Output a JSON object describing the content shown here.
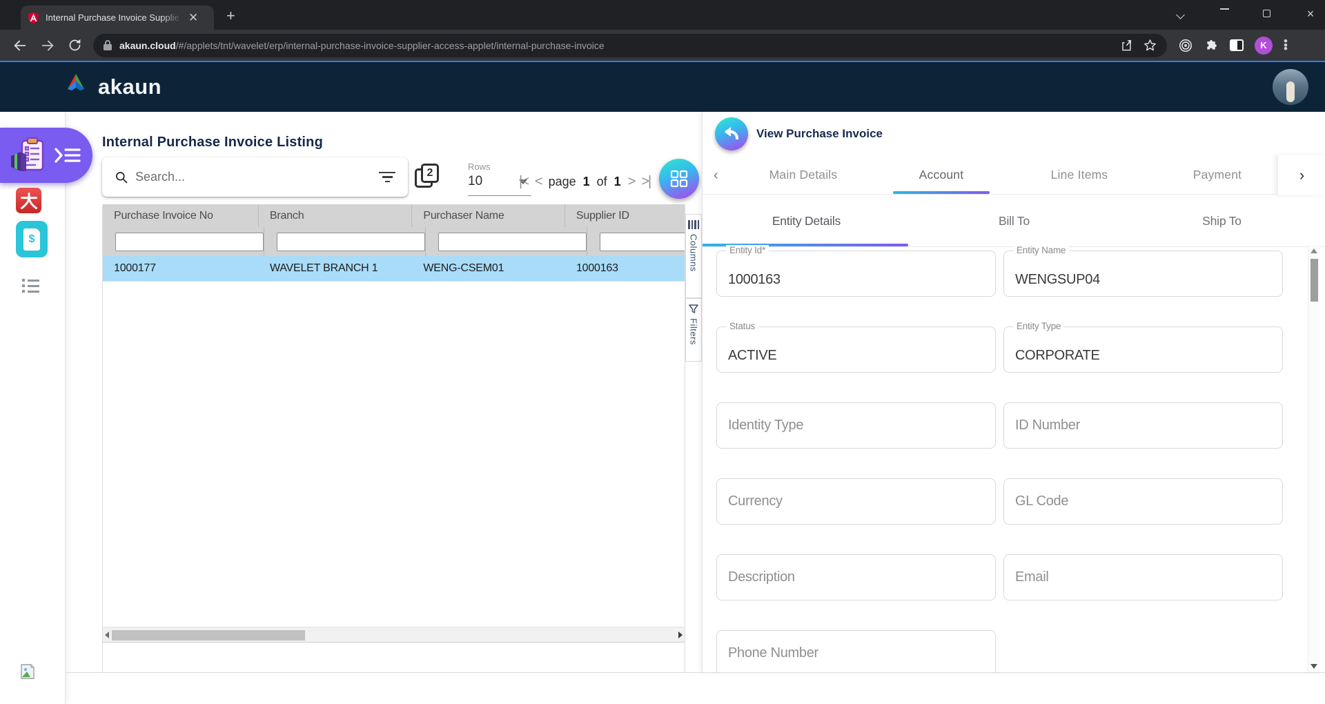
{
  "browser": {
    "tab_title": "Internal Purchase Invoice Supplie",
    "url_host": "akaun.cloud",
    "url_path": "/#/applets/tnt/wavelet/erp/internal-purchase-invoice-supplier-access-applet/internal-purchase-invoice",
    "profile_initial": "K"
  },
  "header": {
    "brand": "akaun"
  },
  "sidebar": {
    "da_glyph": "大",
    "doc_glyph": "$"
  },
  "listing": {
    "title": "Internal Purchase Invoice Listing",
    "search_placeholder": "Search...",
    "rows_label": "Rows",
    "rows_value": "10",
    "pagination": {
      "page_word": "page",
      "page_num": "1",
      "of_word": "of",
      "page_total": "1"
    },
    "table": {
      "columns": [
        "Purchase Invoice No",
        "Branch",
        "Purchaser Name",
        "Supplier ID"
      ],
      "rows": [
        [
          "1000177",
          "WAVELET BRANCH 1",
          "WENG-CSEM01",
          "1000163"
        ]
      ]
    },
    "side_strip": {
      "columns_label": "Columns",
      "filters_label": "Filters"
    }
  },
  "detail": {
    "title": "View Purchase Invoice",
    "tabs": [
      {
        "label": "Main Details"
      },
      {
        "label": "Account"
      },
      {
        "label": "Line Items"
      },
      {
        "label": "Payment"
      }
    ],
    "active_tab": "Account",
    "subtabs": [
      {
        "label": "Entity Details"
      },
      {
        "label": "Bill To"
      },
      {
        "label": "Ship To"
      }
    ],
    "active_subtab": "Entity Details",
    "fields": [
      {
        "label": "Entity Id*",
        "value": "1000163"
      },
      {
        "label": "Entity Name",
        "value": "WENGSUP04"
      },
      {
        "label": "Status",
        "value": "ACTIVE"
      },
      {
        "label": "Entity Type",
        "value": "CORPORATE"
      },
      {
        "label": "Identity Type",
        "value": ""
      },
      {
        "label": "ID Number",
        "value": ""
      },
      {
        "label": "Currency",
        "value": ""
      },
      {
        "label": "GL Code",
        "value": ""
      },
      {
        "label": "Description",
        "value": ""
      },
      {
        "label": "Email",
        "value": ""
      },
      {
        "label": "Phone Number",
        "value": ""
      }
    ]
  },
  "colors": {
    "accent_gradient_start": "#2fe3d2",
    "accent_gradient_end": "#a050ee",
    "header_navy": "#0d2438",
    "applet_purple": "#7a5cf0",
    "selected_row_blue": "#a8dcf8",
    "angular_red": "#dd0031",
    "blue_focus_line": "#2e7cf6"
  }
}
